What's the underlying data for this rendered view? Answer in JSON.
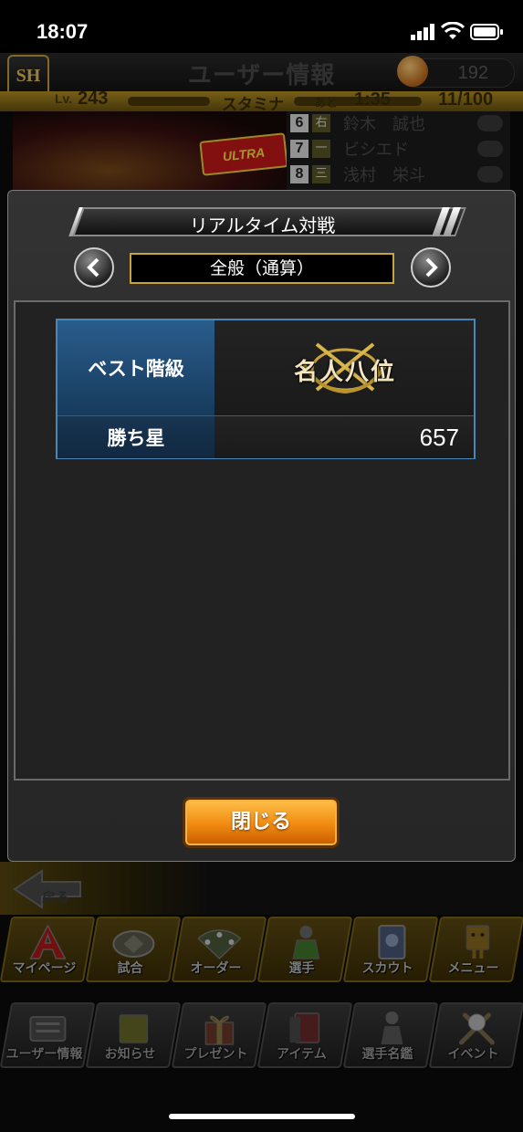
{
  "status_bar": {
    "time": "18:07"
  },
  "header": {
    "team_logo": "SH",
    "title": "ユーザー情報",
    "coins": "192",
    "level_label": "Lv.",
    "level": "243",
    "stamina_label": "スタミナ",
    "stamina_remaining_label": "あと",
    "stamina_timer": "1:35",
    "stamina": "11/100"
  },
  "background": {
    "banner_logo": "ULTRA",
    "order": [
      {
        "num": "6",
        "pos": "右",
        "name": "鈴木　誠也"
      },
      {
        "num": "7",
        "pos": "一",
        "name": "ビシエド"
      },
      {
        "num": "8",
        "pos": "三",
        "name": "浅村　栄斗"
      }
    ]
  },
  "modal": {
    "title": "リアルタイム対戦",
    "tab": "全般（通算）",
    "rows": [
      {
        "label": "ベスト階級",
        "badge_text": "名人八位"
      },
      {
        "label": "勝ち星",
        "value": "657"
      }
    ],
    "close_label": "閉じる"
  },
  "back_label": "戻る",
  "menu_primary": [
    {
      "label": "マイページ",
      "icon": "a-letter-icon"
    },
    {
      "label": "試合",
      "icon": "stadium-icon"
    },
    {
      "label": "オーダー",
      "icon": "field-players-icon"
    },
    {
      "label": "選手",
      "icon": "player-icon"
    },
    {
      "label": "スカウト",
      "icon": "scout-card-icon"
    },
    {
      "label": "メニュー",
      "icon": "menu-block-icon"
    }
  ],
  "menu_secondary": [
    {
      "label": "ユーザー情報",
      "icon": "user-info-icon"
    },
    {
      "label": "お知らせ",
      "icon": "notice-icon"
    },
    {
      "label": "プレゼント",
      "icon": "gift-icon"
    },
    {
      "label": "アイテム",
      "icon": "item-icon"
    },
    {
      "label": "選手名鑑",
      "icon": "player-book-icon"
    },
    {
      "label": "イベント",
      "icon": "event-bat-ball-icon"
    }
  ]
}
